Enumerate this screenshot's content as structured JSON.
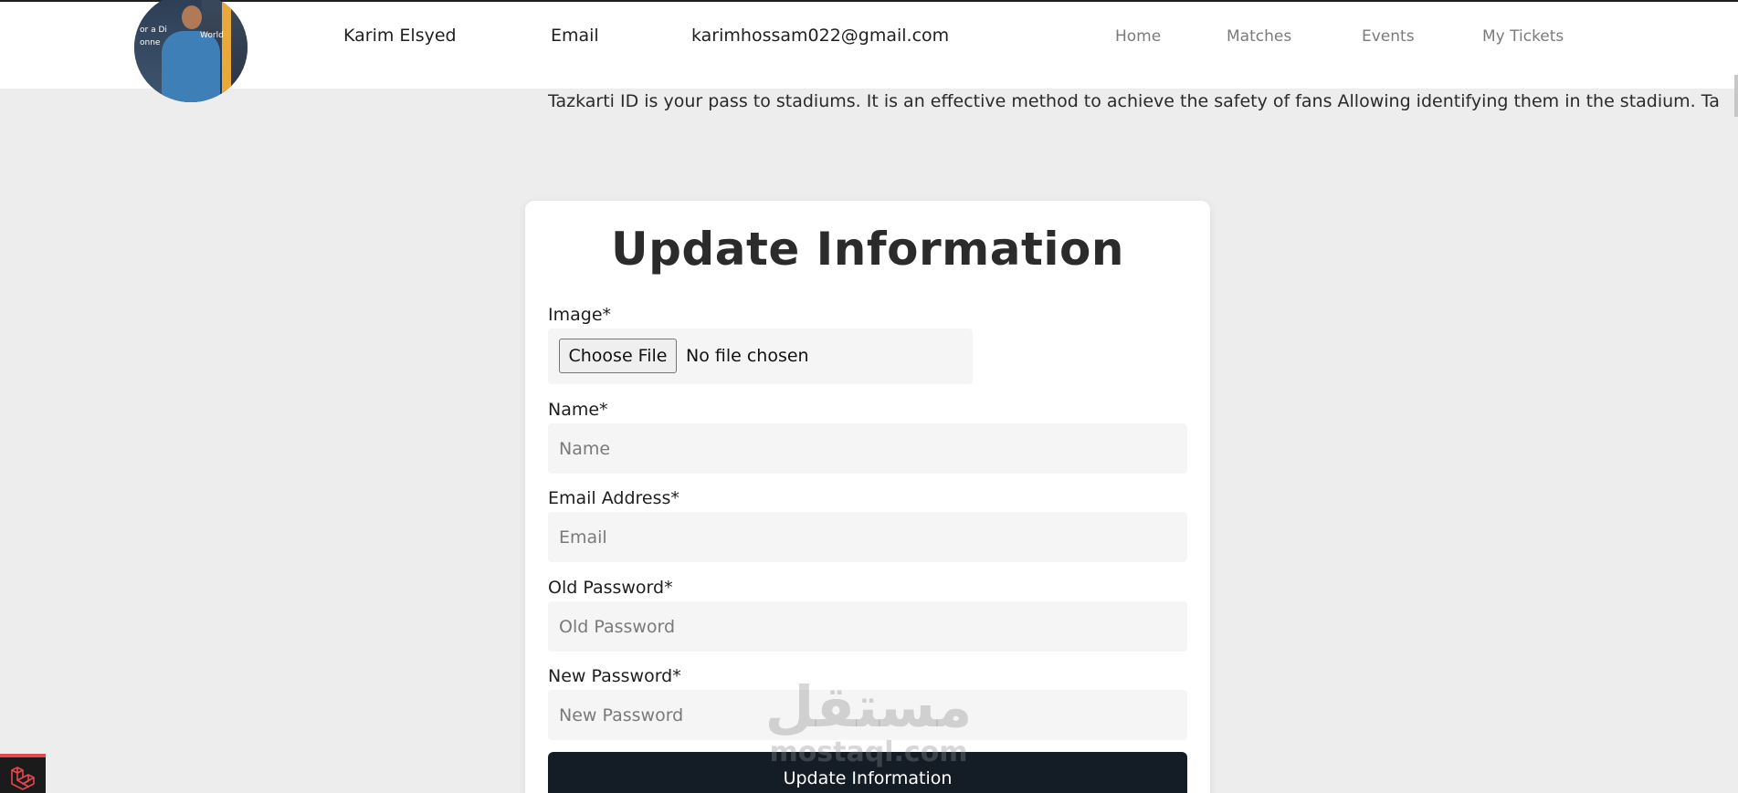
{
  "header": {
    "user_name": "Karim Elsyed",
    "email_label": "Email",
    "email_value": "karimhossam022@gmail.com",
    "nav": {
      "home": "Home",
      "matches": "Matches",
      "events": "Events",
      "tickets": "My Tickets"
    }
  },
  "marquee": {
    "text": "Tazkarti ID is your pass to stadiums. It is an effective method to achieve the safety of fans Allowing identifying them in the stadium. Ta"
  },
  "form": {
    "title": "Update Information",
    "image_label": "Image*",
    "choose_file_label": "Choose File",
    "file_status": "No file chosen",
    "name_label": "Name*",
    "name_placeholder": "Name",
    "email_label": "Email Address*",
    "email_placeholder": "Email",
    "old_password_label": "Old Password*",
    "old_password_placeholder": "Old Password",
    "new_password_label": "New Password*",
    "new_password_placeholder": "New Password",
    "submit_label": "Update Information"
  },
  "watermark": {
    "arabic": "مستقل",
    "latin": "mostaql.com"
  },
  "colors": {
    "page_bg": "#ededed",
    "card_bg": "#ffffff",
    "button_bg": "#141c26",
    "nav_text": "#7b7b7b",
    "badge_accent": "#e5484d"
  },
  "icons": {
    "corner_badge": "laravel-logo-icon"
  }
}
